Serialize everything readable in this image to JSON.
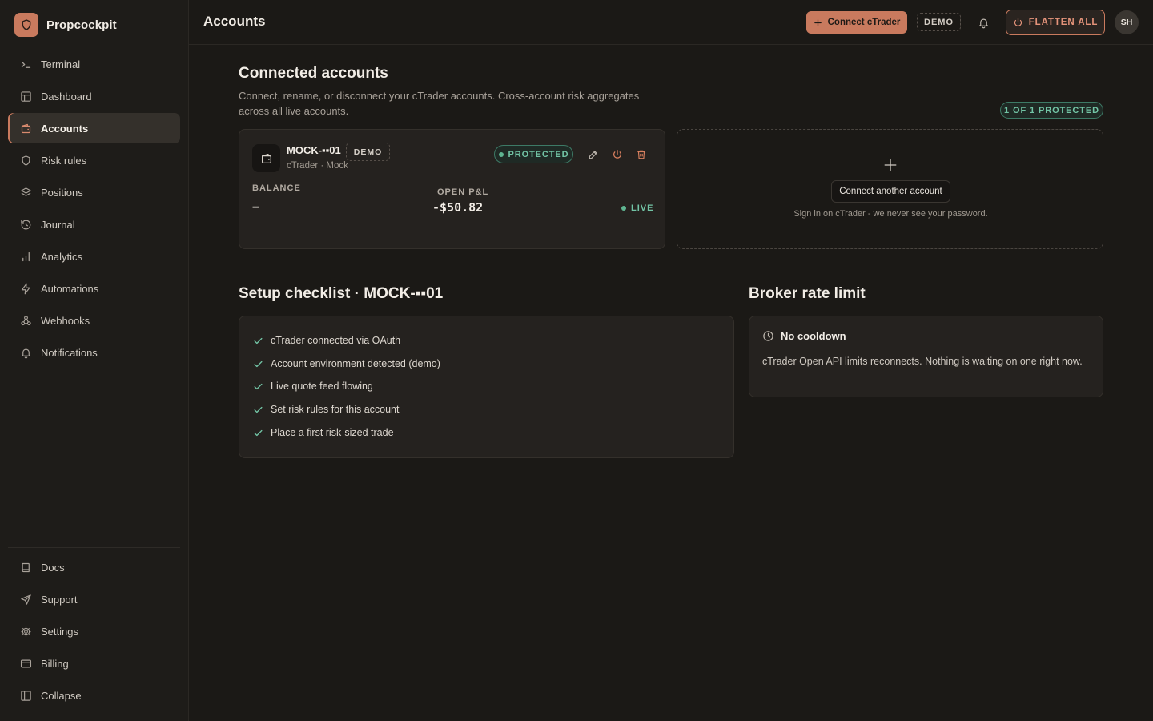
{
  "app": {
    "name": "Propcockpit"
  },
  "sidebar": {
    "items": [
      {
        "label": "Terminal",
        "icon": "terminal-icon"
      },
      {
        "label": "Dashboard",
        "icon": "dashboard-icon"
      },
      {
        "label": "Accounts",
        "icon": "wallet-icon",
        "active": true
      },
      {
        "label": "Risk rules",
        "icon": "shield-icon"
      },
      {
        "label": "Positions",
        "icon": "layers-icon"
      },
      {
        "label": "Journal",
        "icon": "history-icon"
      },
      {
        "label": "Analytics",
        "icon": "bar-chart-icon"
      },
      {
        "label": "Automations",
        "icon": "bolt-icon"
      },
      {
        "label": "Webhooks",
        "icon": "webhook-icon"
      },
      {
        "label": "Notifications",
        "icon": "bell-icon"
      }
    ],
    "bottom": [
      {
        "label": "Docs",
        "icon": "book-icon"
      },
      {
        "label": "Support",
        "icon": "send-icon"
      },
      {
        "label": "Settings",
        "icon": "gear-icon"
      },
      {
        "label": "Billing",
        "icon": "credit-card-icon"
      },
      {
        "label": "Collapse",
        "icon": "sidebar-collapse-icon"
      }
    ]
  },
  "header": {
    "title": "Accounts",
    "connect_label": "Connect cTrader",
    "env_badge": "DEMO",
    "flatten_label": "FLATTEN ALL",
    "avatar_initials": "SH"
  },
  "connected": {
    "title": "Connected accounts",
    "subtitle": "Connect, rename, or disconnect your cTrader accounts. Cross-account risk aggregates across all live accounts.",
    "protected_count": "1 OF 1 PROTECTED"
  },
  "account": {
    "name": "MOCK-▪▪01",
    "env_badge": "DEMO",
    "meta": "cTrader · Mock",
    "status": "PROTECTED",
    "balance_label": "BALANCE",
    "balance_value": "–",
    "pnl_label": "OPEN P&L",
    "pnl_value": "-$50.82",
    "live_label": "LIVE"
  },
  "add_account": {
    "button_label": "Connect another account",
    "hint": "Sign in on cTrader - we never see your password."
  },
  "checklist": {
    "title": "Setup checklist · MOCK-▪▪01",
    "items": [
      "cTrader connected via OAuth",
      "Account environment detected (demo)",
      "Live quote feed flowing",
      "Set risk rules for this account",
      "Place a first risk-sized trade"
    ]
  },
  "rate_limit": {
    "title": "Broker rate limit",
    "status": "No cooldown",
    "description": "cTrader Open API limits reconnects. Nothing is waiting on one right now."
  },
  "colors": {
    "accent": "#c97a5e",
    "success": "#72c4a5",
    "background": "#1b1916",
    "card": "#25221f"
  }
}
